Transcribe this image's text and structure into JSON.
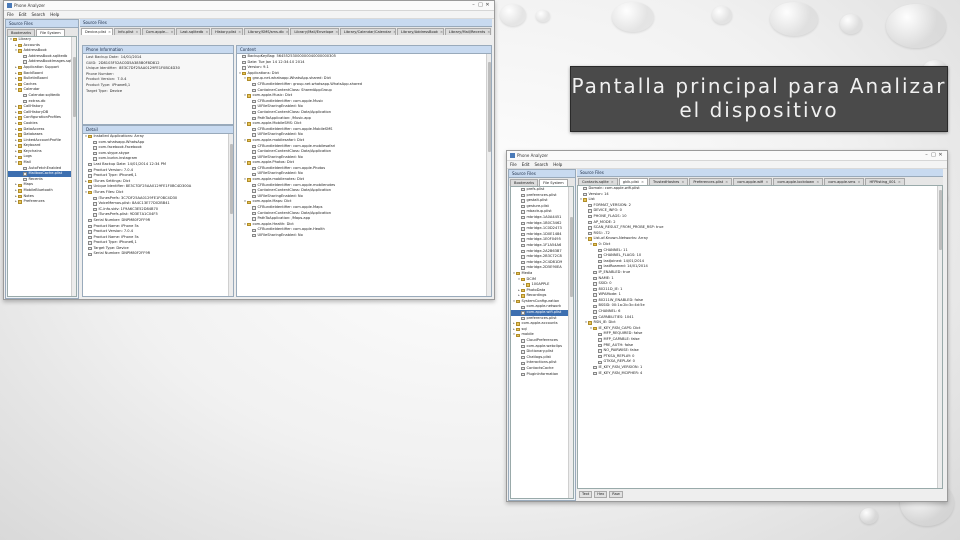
{
  "left_window": {
    "title": "Phone Analyzer",
    "menu": [
      "File",
      "Edit",
      "Search",
      "Help"
    ],
    "sidebar_header": "Source Files",
    "sidebar_tabs": [
      "Bookmarks",
      "File System"
    ],
    "sidebar_tree": [
      {
        "d": 0,
        "t": "Library",
        "k": "fold",
        "o": true
      },
      {
        "d": 1,
        "t": "Accounts",
        "k": "fold"
      },
      {
        "d": 1,
        "t": "AddressBook",
        "k": "fold",
        "o": true
      },
      {
        "d": 2,
        "t": "AddressBook.sqlitedb",
        "k": "leaf"
      },
      {
        "d": 2,
        "t": "AddressBookImages.sqlitedb",
        "k": "leaf"
      },
      {
        "d": 1,
        "t": "Application Support",
        "k": "fold"
      },
      {
        "d": 1,
        "t": "BackBoard",
        "k": "fold"
      },
      {
        "d": 1,
        "t": "BulletinBoard",
        "k": "fold"
      },
      {
        "d": 1,
        "t": "Caches",
        "k": "fold"
      },
      {
        "d": 1,
        "t": "Calendar",
        "k": "fold",
        "o": true
      },
      {
        "d": 2,
        "t": "Calendar.sqlitedb",
        "k": "leaf"
      },
      {
        "d": 2,
        "t": "extras.db",
        "k": "leaf"
      },
      {
        "d": 1,
        "t": "CallHistory",
        "k": "fold"
      },
      {
        "d": 1,
        "t": "CallHistoryDB",
        "k": "fold"
      },
      {
        "d": 1,
        "t": "ConfigurationProfiles",
        "k": "fold"
      },
      {
        "d": 1,
        "t": "Cookies",
        "k": "fold"
      },
      {
        "d": 1,
        "t": "DataAccess",
        "k": "fold"
      },
      {
        "d": 1,
        "t": "Databases",
        "k": "fold"
      },
      {
        "d": 1,
        "t": "LinkedAccountProfile",
        "k": "fold"
      },
      {
        "d": 1,
        "t": "Keyboard",
        "k": "fold"
      },
      {
        "d": 1,
        "t": "Keychains",
        "k": "fold"
      },
      {
        "d": 1,
        "t": "Logs",
        "k": "fold"
      },
      {
        "d": 1,
        "t": "Mail",
        "k": "fold",
        "o": true
      },
      {
        "d": 2,
        "t": "AutoFetchEnabled",
        "k": "leaf"
      },
      {
        "d": 2,
        "t": "MailboxCache.plist",
        "k": "leaf",
        "s": true
      },
      {
        "d": 2,
        "t": "Recents",
        "k": "leaf"
      },
      {
        "d": 1,
        "t": "Maps",
        "k": "fold"
      },
      {
        "d": 1,
        "t": "MobileBluetooth",
        "k": "fold"
      },
      {
        "d": 1,
        "t": "Notes",
        "k": "fold"
      },
      {
        "d": 1,
        "t": "Preferences",
        "k": "fold"
      }
    ],
    "viewer_header": "Source Files",
    "viewer_tabs": [
      "Device.plist",
      "Info.plist",
      "Com.apple...",
      "Last.sqlitedb",
      "History.plist",
      "Library/SMS/sms.db",
      "Library/Mail/Envelope",
      "Library/Calendar/Calendar",
      "Library/AddressBook",
      "Library/Mail/Recents"
    ],
    "phone_info_header": "Phone Information",
    "phone_info": [
      {
        "k": "Last Backup Date:",
        "v": "14/01/2014"
      },
      {
        "k": "GUID:",
        "v": "2D8103F52AC0D5A385B0F8D812"
      },
      {
        "k": "Unique Identifier:",
        "v": "8E3C7DF25AA0129FE1F0BC4D30"
      },
      {
        "k": "Phone Number:",
        "v": ""
      },
      {
        "k": "Product Version:",
        "v": "7.0.4"
      },
      {
        "k": "Product Type:",
        "v": "iPhone6,1"
      },
      {
        "k": "Target Type:",
        "v": "Device"
      }
    ],
    "detail_header": "Detail",
    "detail_tree": [
      {
        "d": 0,
        "t": "Installed Applications: Array",
        "k": "fold",
        "o": true
      },
      {
        "d": 1,
        "t": "com.whatsapp.WhatsApp",
        "k": "leaf"
      },
      {
        "d": 1,
        "t": "com.facebook.Facebook",
        "k": "leaf"
      },
      {
        "d": 1,
        "t": "com.skype.skype",
        "k": "leaf"
      },
      {
        "d": 1,
        "t": "com.burbn.instagram",
        "k": "leaf"
      },
      {
        "d": 0,
        "t": "Last Backup Date: 14/01/2014 12:34 PM",
        "k": "leaf"
      },
      {
        "d": 0,
        "t": "Product Version: 7.0.4",
        "k": "leaf"
      },
      {
        "d": 0,
        "t": "Product Type: iPhone6,1",
        "k": "leaf"
      },
      {
        "d": 0,
        "t": "iTunes Settings: Dict",
        "k": "fold"
      },
      {
        "d": 0,
        "t": "Unique Identifier: 8E3C7DF25AA0129FE1F0BC4D300A",
        "k": "leaf"
      },
      {
        "d": 0,
        "t": "iTunes Files: Dict",
        "k": "fold",
        "o": true
      },
      {
        "d": 1,
        "t": "iTunesPrefs: 3C7DF25AA0129FE1F0BC4D30",
        "k": "leaf"
      },
      {
        "d": 1,
        "t": "VoiceMemos.plist: 8A4C13E77D02BB41",
        "k": "leaf"
      },
      {
        "d": 1,
        "t": "IC-Info.sidv: 1F9A6C3E52D84B70",
        "k": "leaf"
      },
      {
        "d": 1,
        "t": "iTunesPrefs.plist: 9D3E7A1C04F5",
        "k": "leaf"
      },
      {
        "d": 0,
        "t": "Serial Number: DNPM80F2FF9R",
        "k": "leaf"
      },
      {
        "d": 0,
        "t": "Product Name: iPhone 5s",
        "k": "leaf"
      },
      {
        "d": 0,
        "t": "Product Version: 7.0.4",
        "k": "leaf"
      },
      {
        "d": 0,
        "t": "Product Name: iPhone 5s",
        "k": "leaf"
      },
      {
        "d": 0,
        "t": "Product Type: iPhone6,1",
        "k": "leaf"
      },
      {
        "d": 0,
        "t": "Target Type: Device",
        "k": "leaf"
      },
      {
        "d": 0,
        "t": "Serial Number: DNPM80F2FF9R",
        "k": "leaf"
      }
    ],
    "right_header": "Content",
    "right_tree": [
      {
        "d": 0,
        "t": "BackupKeyBag: 56455253000000040000000305",
        "k": "leaf"
      },
      {
        "d": 0,
        "t": "Date: Tue Jan 14 12:34:10 2014",
        "k": "leaf"
      },
      {
        "d": 0,
        "t": "Version: 9.1",
        "k": "leaf"
      },
      {
        "d": 0,
        "t": "Applications: Dict",
        "k": "fold",
        "o": true
      },
      {
        "d": 1,
        "t": "group.net.whatsapp.WhatsApp.shared: Dict",
        "k": "fold",
        "o": true
      },
      {
        "d": 2,
        "t": "CFBundleIdentifier: group.net.whatsapp.WhatsApp.shared",
        "k": "leaf"
      },
      {
        "d": 2,
        "t": "ContainerContentClass: SharedAppGroup",
        "k": "leaf"
      },
      {
        "d": 1,
        "t": "com.apple.Music: Dict",
        "k": "fold",
        "o": true
      },
      {
        "d": 2,
        "t": "CFBundleIdentifier: com.apple.Music",
        "k": "leaf"
      },
      {
        "d": 2,
        "t": "UIFileSharingEnabled: No",
        "k": "leaf"
      },
      {
        "d": 2,
        "t": "ContainerContentClass: Data/Application",
        "k": "leaf"
      },
      {
        "d": 2,
        "t": "PathToApplication: /Music.app",
        "k": "leaf"
      },
      {
        "d": 1,
        "t": "com.apple.MobileSMS: Dict",
        "k": "fold",
        "o": true
      },
      {
        "d": 2,
        "t": "CFBundleIdentifier: com.apple.MobileSMS",
        "k": "leaf"
      },
      {
        "d": 2,
        "t": "UIFileSharingEnabled: No",
        "k": "leaf"
      },
      {
        "d": 1,
        "t": "com.apple.mobilesafari: Dict",
        "k": "fold",
        "o": true
      },
      {
        "d": 2,
        "t": "CFBundleIdentifier: com.apple.mobilesafari",
        "k": "leaf"
      },
      {
        "d": 2,
        "t": "ContainerContentClass: Data/Application",
        "k": "leaf"
      },
      {
        "d": 2,
        "t": "UIFileSharingEnabled: No",
        "k": "leaf"
      },
      {
        "d": 1,
        "t": "com.apple.Photos: Dict",
        "k": "fold",
        "o": true
      },
      {
        "d": 2,
        "t": "CFBundleIdentifier: com.apple.Photos",
        "k": "leaf"
      },
      {
        "d": 2,
        "t": "UIFileSharingEnabled: No",
        "k": "leaf"
      },
      {
        "d": 1,
        "t": "com.apple.mobilenotes: Dict",
        "k": "fold",
        "o": true
      },
      {
        "d": 2,
        "t": "CFBundleIdentifier: com.apple.mobilenotes",
        "k": "leaf"
      },
      {
        "d": 2,
        "t": "ContainerContentClass: Data/Application",
        "k": "leaf"
      },
      {
        "d": 2,
        "t": "UIFileSharingEnabled: No",
        "k": "leaf"
      },
      {
        "d": 1,
        "t": "com.apple.Maps: Dict",
        "k": "fold",
        "o": true
      },
      {
        "d": 2,
        "t": "CFBundleIdentifier: com.apple.Maps",
        "k": "leaf"
      },
      {
        "d": 2,
        "t": "ContainerContentClass: Data/Application",
        "k": "leaf"
      },
      {
        "d": 2,
        "t": "PathToApplication: /Maps.app",
        "k": "leaf"
      },
      {
        "d": 1,
        "t": "com.apple.Health: Dict",
        "k": "fold",
        "o": true
      },
      {
        "d": 2,
        "t": "CFBundleIdentifier: com.apple.Health",
        "k": "leaf"
      },
      {
        "d": 2,
        "t": "UIFileSharingEnabled: No",
        "k": "leaf"
      }
    ]
  },
  "right_window": {
    "title": "Phone Analyzer",
    "menu": [
      "File",
      "Edit",
      "Search",
      "Help"
    ],
    "sidebar_header": "Source Files",
    "sidebar_tabs": [
      "Bookmarks",
      "File System"
    ],
    "sidebar_tree": [
      {
        "d": 1,
        "t": "prefs.plist",
        "k": "leaf"
      },
      {
        "d": 1,
        "t": "preferences.plist",
        "k": "leaf"
      },
      {
        "d": 1,
        "t": "gestalt.plist",
        "k": "leaf"
      },
      {
        "d": 1,
        "t": "gesture.plist",
        "k": "leaf"
      },
      {
        "d": 1,
        "t": "mbackup.plist",
        "k": "leaf"
      },
      {
        "d": 1,
        "t": "mbridge-1A0A4451",
        "k": "leaf"
      },
      {
        "d": 1,
        "t": "mbridge-1B0C3462",
        "k": "leaf"
      },
      {
        "d": 1,
        "t": "mbridge-1C0D2473",
        "k": "leaf"
      },
      {
        "d": 1,
        "t": "mbridge-1D0E1484",
        "k": "leaf"
      },
      {
        "d": 1,
        "t": "mbridge-1E0F0495",
        "k": "leaf"
      },
      {
        "d": 1,
        "t": "mbridge-1F1A54A6",
        "k": "leaf"
      },
      {
        "d": 1,
        "t": "mbridge-2A2B63B7",
        "k": "leaf"
      },
      {
        "d": 1,
        "t": "mbridge-2B3C72C8",
        "k": "leaf"
      },
      {
        "d": 1,
        "t": "mbridge-2C4D81D9",
        "k": "leaf"
      },
      {
        "d": 1,
        "t": "mbridge-2D5E90EA",
        "k": "leaf"
      },
      {
        "d": 0,
        "t": "Media",
        "k": "fold",
        "o": true
      },
      {
        "d": 1,
        "t": "DCIM",
        "k": "fold",
        "o": true
      },
      {
        "d": 2,
        "t": "100APPLE",
        "k": "fold"
      },
      {
        "d": 1,
        "t": "PhotoData",
        "k": "fold"
      },
      {
        "d": 1,
        "t": "Recordings",
        "k": "fold"
      },
      {
        "d": 0,
        "t": "SystemConfiguration",
        "k": "fold",
        "o": true
      },
      {
        "d": 1,
        "t": "com.apple.network",
        "k": "leaf"
      },
      {
        "d": 1,
        "t": "com.apple.wifi.plist",
        "k": "leaf",
        "s": true
      },
      {
        "d": 1,
        "t": "preferences.plist",
        "k": "leaf"
      },
      {
        "d": 0,
        "t": "com.apple.accounts",
        "k": "fold"
      },
      {
        "d": 0,
        "t": "sql",
        "k": "fold"
      },
      {
        "d": 0,
        "t": "mobile",
        "k": "fold",
        "o": true
      },
      {
        "d": 1,
        "t": "CloudPreferences",
        "k": "leaf"
      },
      {
        "d": 1,
        "t": "com.apple.webclips",
        "k": "leaf"
      },
      {
        "d": 1,
        "t": "Dictionary.plist",
        "k": "leaf"
      },
      {
        "d": 1,
        "t": "Chatlogs.plist",
        "k": "leaf"
      },
      {
        "d": 1,
        "t": "Interactions.plist",
        "k": "leaf"
      },
      {
        "d": 1,
        "t": "ContactsCache",
        "k": "leaf"
      },
      {
        "d": 1,
        "t": "PluginInformation",
        "k": "leaf"
      }
    ],
    "viewer_header": "Source Files",
    "viewer_tabs": [
      "Contacts.sqlite",
      "gklk.plist",
      "TrustedHashes",
      "Preferences.plist",
      "com.apple.wifi",
      "com.apple.lockdown",
      "com.apple.sms",
      "HFPlisting_001"
    ],
    "content_tree": [
      {
        "d": 0,
        "t": "Domain: com.apple.wifi.plist",
        "k": "leaf"
      },
      {
        "d": 0,
        "t": "Version: 14",
        "k": "leaf"
      },
      {
        "d": 0,
        "t": "List",
        "k": "fold",
        "o": true
      },
      {
        "d": 1,
        "t": "FORMAT_VERSION: 2",
        "k": "leaf"
      },
      {
        "d": 1,
        "t": "DEVICE_INFO: 0",
        "k": "leaf"
      },
      {
        "d": 1,
        "t": "PHONE_FLAGS: 10",
        "k": "leaf"
      },
      {
        "d": 1,
        "t": "AP_MODE: 2",
        "k": "leaf"
      },
      {
        "d": 1,
        "t": "SCAN_RESULT_FROM_PROBE_RSP: true",
        "k": "leaf"
      },
      {
        "d": 1,
        "t": "RSSI: -72",
        "k": "leaf"
      },
      {
        "d": 1,
        "t": "List-of-Known-Networks: Array",
        "k": "fold",
        "o": true
      },
      {
        "d": 2,
        "t": "0: Dict",
        "k": "fold",
        "o": true
      },
      {
        "d": 3,
        "t": "CHANNEL: 11",
        "k": "leaf"
      },
      {
        "d": 3,
        "t": "CHANNEL_FLAGS: 10",
        "k": "leaf"
      },
      {
        "d": 3,
        "t": "lastJoined: 14/01/2014",
        "k": "leaf"
      },
      {
        "d": 3,
        "t": "lastRoamed: 14/01/2014",
        "k": "leaf"
      },
      {
        "d": 2,
        "t": "IP_ENABLED: true",
        "k": "leaf"
      },
      {
        "d": 2,
        "t": "NAME: 1",
        "k": "leaf"
      },
      {
        "d": 2,
        "t": "SSID: 0",
        "k": "leaf"
      },
      {
        "d": 2,
        "t": "80211D_IE: 1",
        "k": "leaf"
      },
      {
        "d": 2,
        "t": "WPAMode: 1",
        "k": "leaf"
      },
      {
        "d": 2,
        "t": "80211W_ENABLED: false",
        "k": "leaf"
      },
      {
        "d": 2,
        "t": "BSSID: 00:1a:2b:3c:4d:5e",
        "k": "leaf"
      },
      {
        "d": 2,
        "t": "CHANNEL: 6",
        "k": "leaf"
      },
      {
        "d": 2,
        "t": "CAPABILITIES: 1041",
        "k": "leaf"
      },
      {
        "d": 1,
        "t": "RSN_IE: Dict",
        "k": "fold",
        "o": true
      },
      {
        "d": 2,
        "t": "IE_KEY_RSN_CAPS: Dict",
        "k": "fold",
        "o": true
      },
      {
        "d": 3,
        "t": "MFP_REQUIRED: false",
        "k": "leaf"
      },
      {
        "d": 3,
        "t": "MFP_CAPABLE: false",
        "k": "leaf"
      },
      {
        "d": 3,
        "t": "PRE_AUTH: false",
        "k": "leaf"
      },
      {
        "d": 3,
        "t": "NO_PAIRWISE: false",
        "k": "leaf"
      },
      {
        "d": 3,
        "t": "PTKSA_REPLAY: 0",
        "k": "leaf"
      },
      {
        "d": 3,
        "t": "GTKSA_REPLAY: 0",
        "k": "leaf"
      },
      {
        "d": 2,
        "t": "IE_KEY_RSN_VERSION: 1",
        "k": "leaf"
      },
      {
        "d": 2,
        "t": "IE_KEY_RSN_MCIPHER: 4",
        "k": "leaf"
      }
    ],
    "bottom_tabs": [
      "Text",
      "Hex",
      "Raw"
    ]
  },
  "callout": {
    "line1": "Pantalla principal para Analizar",
    "line2": "el dispositivo"
  }
}
